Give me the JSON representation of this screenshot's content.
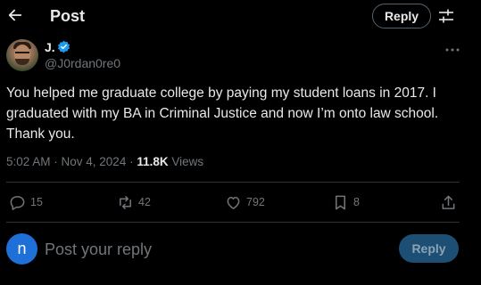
{
  "header": {
    "title": "Post",
    "reply_label": "Reply"
  },
  "author": {
    "name": "J.",
    "handle": "@J0rdan0re0",
    "verified": true
  },
  "tweet": {
    "text": "You helped me graduate college by paying my student loans in 2017. I graduated with my BA in Criminal Justice and now I’m onto law school. Thank you.",
    "timestamp": "5:02 AM · Nov 4, 2024 · ",
    "views_count": "11.8K",
    "views_label": " Views"
  },
  "actions": {
    "replies": "15",
    "reposts": "42",
    "likes": "792",
    "bookmarks": "8"
  },
  "composer": {
    "avatar_letter": "n",
    "placeholder": "Post your reply",
    "reply_label": "Reply"
  },
  "colors": {
    "background": "#000000",
    "text": "#e7e9ea",
    "muted": "#71767b",
    "accent": "#1d9bf0",
    "divider": "#2f3336"
  },
  "icons": [
    "back-arrow-icon",
    "filter-icon",
    "verified-badge-icon",
    "more-icon",
    "reply-icon",
    "repost-icon",
    "like-icon",
    "bookmark-icon",
    "share-icon"
  ]
}
